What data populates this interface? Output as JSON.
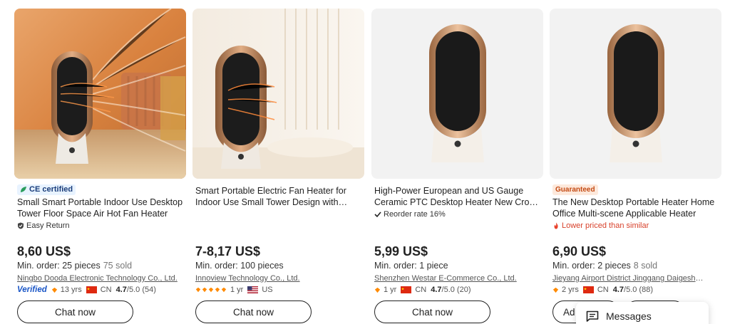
{
  "products": [
    {
      "badge_type": "ce",
      "badge_text": "CE certified",
      "title": "Small Smart Portable Indoor Use Desktop Tower Floor Space Air Hot Fan Heater",
      "tag": "Easy Return",
      "tag_icon": "shield-check-icon",
      "price": "8,60 US$",
      "min_order": "Min. order: 25 pieces",
      "sold": "75 sold",
      "supplier": "Ningbo Dooda Electronic Technology Co., Ltd.",
      "verified": "Verified",
      "years": "13 yrs",
      "country": "CN",
      "rating": "4.7",
      "rating_rest": "/5.0 (54)",
      "button": "Chat now"
    },
    {
      "badge_type": "none",
      "title": "Smart Portable Electric Fan Heater for Indoor Use Small Tower Design with Lighting Function for Bedroom Home Use",
      "price": "7-8,17 US$",
      "min_order": "Min. order: 100 pieces",
      "supplier": "Innoview Technology Co., Ltd.",
      "years": "1 yr",
      "country": "US",
      "button": "Chat now"
    },
    {
      "badge_type": "none",
      "title": "High-Power European and US Gauge Ceramic PTC Desktop Heater New Cross-Border Portable Household Fan Heater",
      "tag": "Reorder rate 16%",
      "tag_icon": "checkmark-icon",
      "price": "5,99 US$",
      "min_order": "Min. order: 1 piece",
      "supplier": "Shenzhen Westar E-Commerce Co., Ltd.",
      "years": "1 yr",
      "country": "CN",
      "rating": "4.7",
      "rating_rest": "/5.0 (20)",
      "button": "Chat now"
    },
    {
      "badge_type": "guaranteed",
      "badge_text": "Guaranteed",
      "title": "The New Desktop Portable Heater Home Office Multi-scene Applicable Heater",
      "tag": "Lower priced than similar",
      "tag_icon": "flame-icon",
      "price": "6,90 US$",
      "min_order": "Min. order: 2 pieces",
      "sold": "8 sold",
      "supplier": "Jieyang Airport District Jinggang Daigeshang Trading Co., Ltd.",
      "years": "2 yrs",
      "country": "CN",
      "rating": "4.7",
      "rating_rest": "/5.0 (88)",
      "button_left": "Ad",
      "button": "Chat now"
    }
  ],
  "messages_label": "Messages",
  "colors": {
    "brand_orange": "#ff6a00",
    "verified_blue": "#1a56c7",
    "discount_red": "#d8412b",
    "heater_copper": "#c98a5e"
  }
}
